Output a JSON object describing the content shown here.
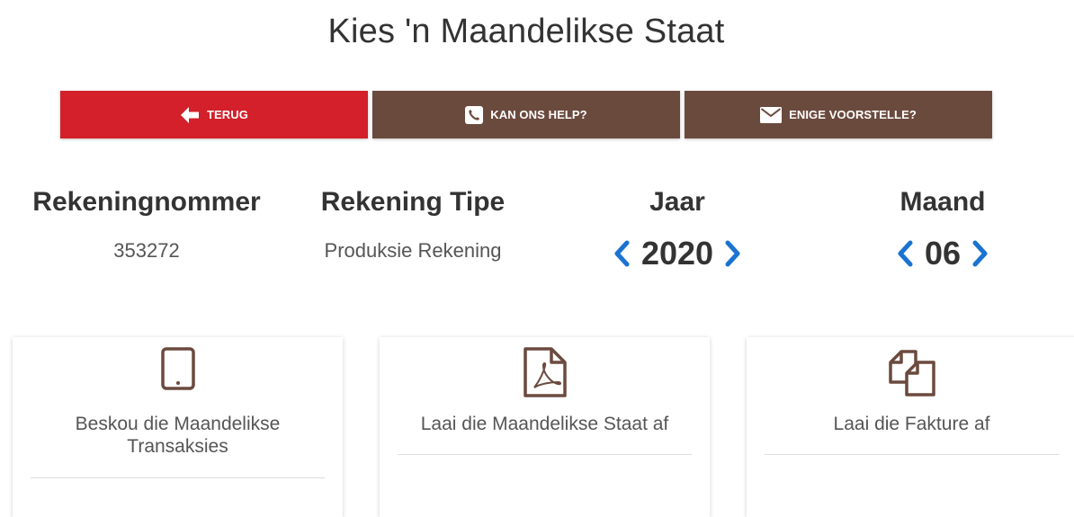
{
  "page_title": "Kies 'n Maandelikse Staat",
  "actions": {
    "back_label": "TERUG",
    "help_label": "KAN ONS HELP?",
    "suggest_label": "ENIGE VOORSTELLE?"
  },
  "colors": {
    "back_button": "#d3202a",
    "brown_button": "#6b4a3e",
    "chevron": "#1a73d1",
    "card_icon": "#6b4a3e"
  },
  "account": {
    "number_label": "Rekeningnommer",
    "number_value": "353272",
    "type_label": "Rekening Tipe",
    "type_value": "Produksie Rekening"
  },
  "period": {
    "year_label": "Jaar",
    "year_value": "2020",
    "month_label": "Maand",
    "month_value": "06"
  },
  "cards": [
    {
      "icon": "tablet-icon",
      "label": "Beskou die Maandelikse Transaksies"
    },
    {
      "icon": "pdf-file-icon",
      "label": "Laai die Maandelikse Staat af"
    },
    {
      "icon": "copy-documents-icon",
      "label": "Laai die Fakture af"
    }
  ]
}
